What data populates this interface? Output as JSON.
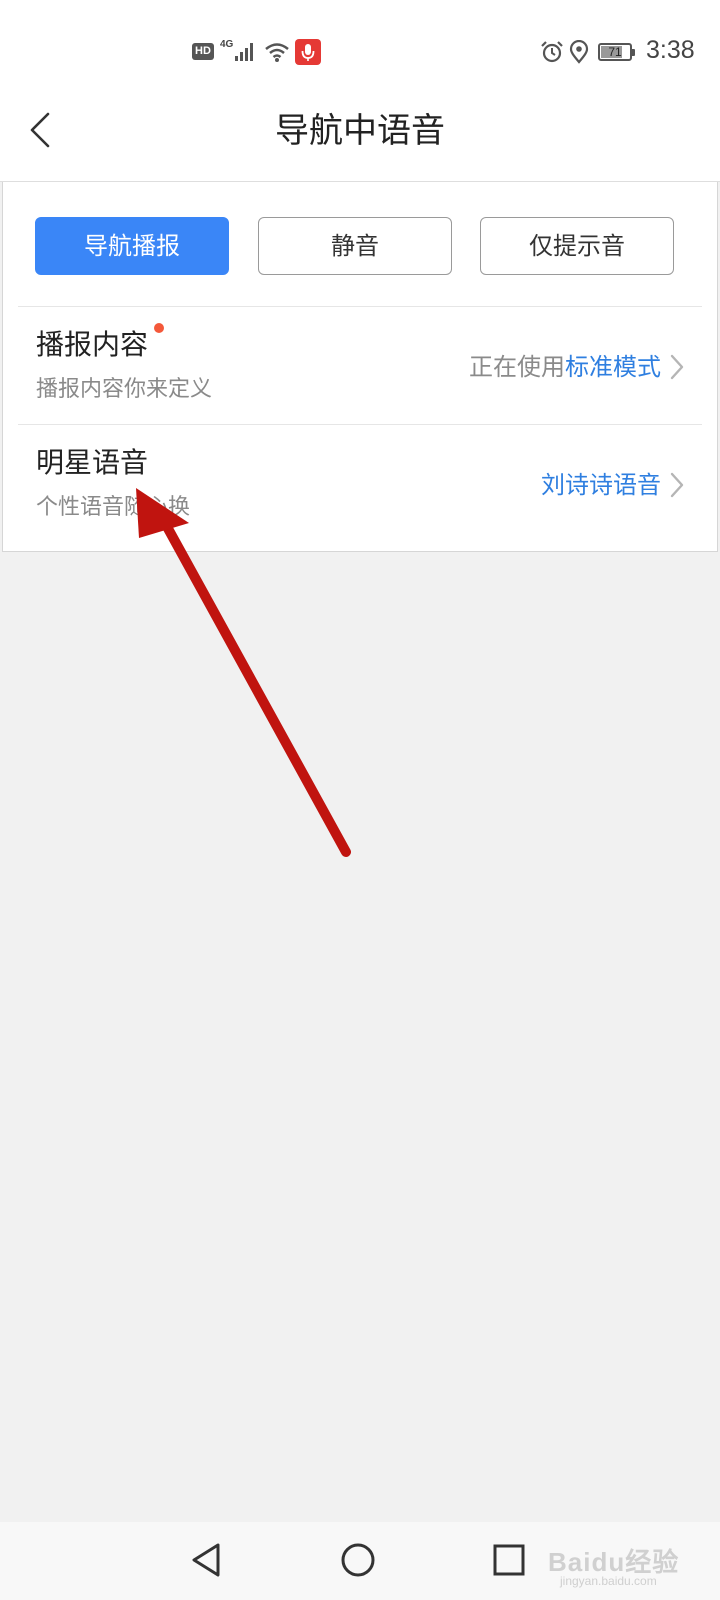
{
  "status_bar": {
    "hd_badge": "HD",
    "network": "4G",
    "battery_level": 71,
    "battery_text": "71",
    "time": "3:38",
    "icons": [
      "hd-icon",
      "signal-icon",
      "wifi-icon",
      "microphone-icon",
      "alarm-icon",
      "location-icon",
      "battery-icon"
    ]
  },
  "header": {
    "title": "导航中语音",
    "back_icon": "chevron-left-icon"
  },
  "modes": {
    "items": [
      {
        "label": "导航播报",
        "active": true
      },
      {
        "label": "静音",
        "active": false
      },
      {
        "label": "仅提示音",
        "active": false
      }
    ],
    "active_color": "#3a86f7"
  },
  "settings": {
    "rows": [
      {
        "title": "播报内容",
        "subtitle": "播报内容你来定义",
        "value_prefix": "正在使用",
        "value_highlight": "标准模式",
        "has_badge": true
      },
      {
        "title": "明星语音",
        "subtitle": "个性语音随心换",
        "value_prefix": "",
        "value_highlight": "刘诗诗语音",
        "has_badge": false
      }
    ],
    "highlight_color": "#2f7fe0",
    "badge_color": "#f4583a"
  },
  "annotation": {
    "type": "arrow",
    "color": "#c0140f"
  },
  "nav_bar": {
    "icons": [
      "back-triangle-icon",
      "home-circle-icon",
      "recents-square-icon"
    ]
  },
  "watermark": {
    "text": "Baidu经验",
    "sub": "jingyan.baidu.com"
  }
}
